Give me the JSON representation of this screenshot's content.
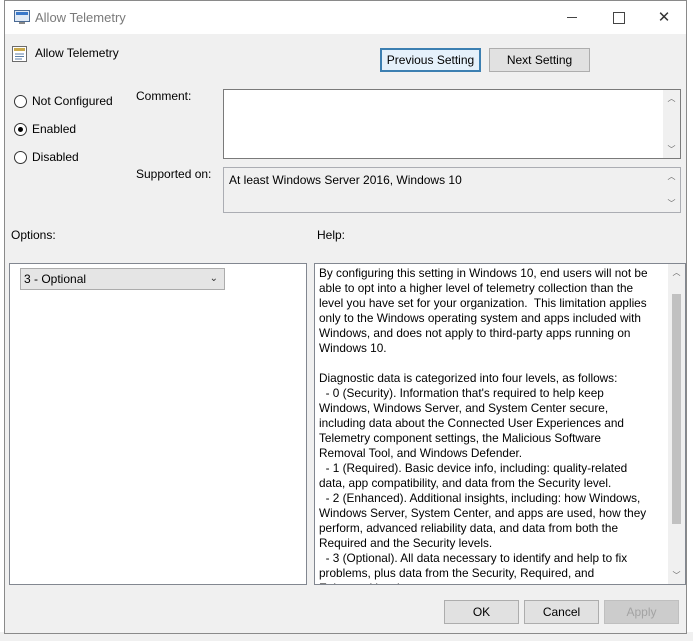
{
  "window": {
    "title": "Allow Telemetry",
    "controls": {
      "minimize": "",
      "maximize": "",
      "close": "✕"
    }
  },
  "policy": {
    "name": "Allow Telemetry"
  },
  "nav": {
    "previous": "Previous Setting",
    "next": "Next Setting"
  },
  "state": {
    "options": [
      {
        "label": "Not Configured",
        "checked": false
      },
      {
        "label": "Enabled",
        "checked": true
      },
      {
        "label": "Disabled",
        "checked": false
      }
    ]
  },
  "comment": {
    "label": "Comment:",
    "value": ""
  },
  "supported": {
    "label": "Supported on:",
    "value": "At least Windows Server 2016, Windows 10"
  },
  "options_section": {
    "label": "Options:",
    "selected": "3 - Optional"
  },
  "help_section": {
    "label": "Help:",
    "text": "By configuring this setting in Windows 10, end users will not be able to opt into a higher level of telemetry collection than the level you have set for your organization.  This limitation applies only to the Windows operating system and apps included with Windows, and does not apply to third-party apps running on Windows 10.\n\nDiagnostic data is categorized into four levels, as follows:\n  - 0 (Security). Information that's required to help keep Windows, Windows Server, and System Center secure, including data about the Connected User Experiences and Telemetry component settings, the Malicious Software Removal Tool, and Windows Defender.\n  - 1 (Required). Basic device info, including: quality-related data, app compatibility, and data from the Security level.\n  - 2 (Enhanced). Additional insights, including: how Windows, Windows Server, System Center, and apps are used, how they perform, advanced reliability data, and data from both the Required and the Security levels.\n  - 3 (Optional). All data necessary to identify and help to fix problems, plus data from the Security, Required, and Enhanced levels."
  },
  "footer": {
    "ok": "OK",
    "cancel": "Cancel",
    "apply": "Apply"
  }
}
